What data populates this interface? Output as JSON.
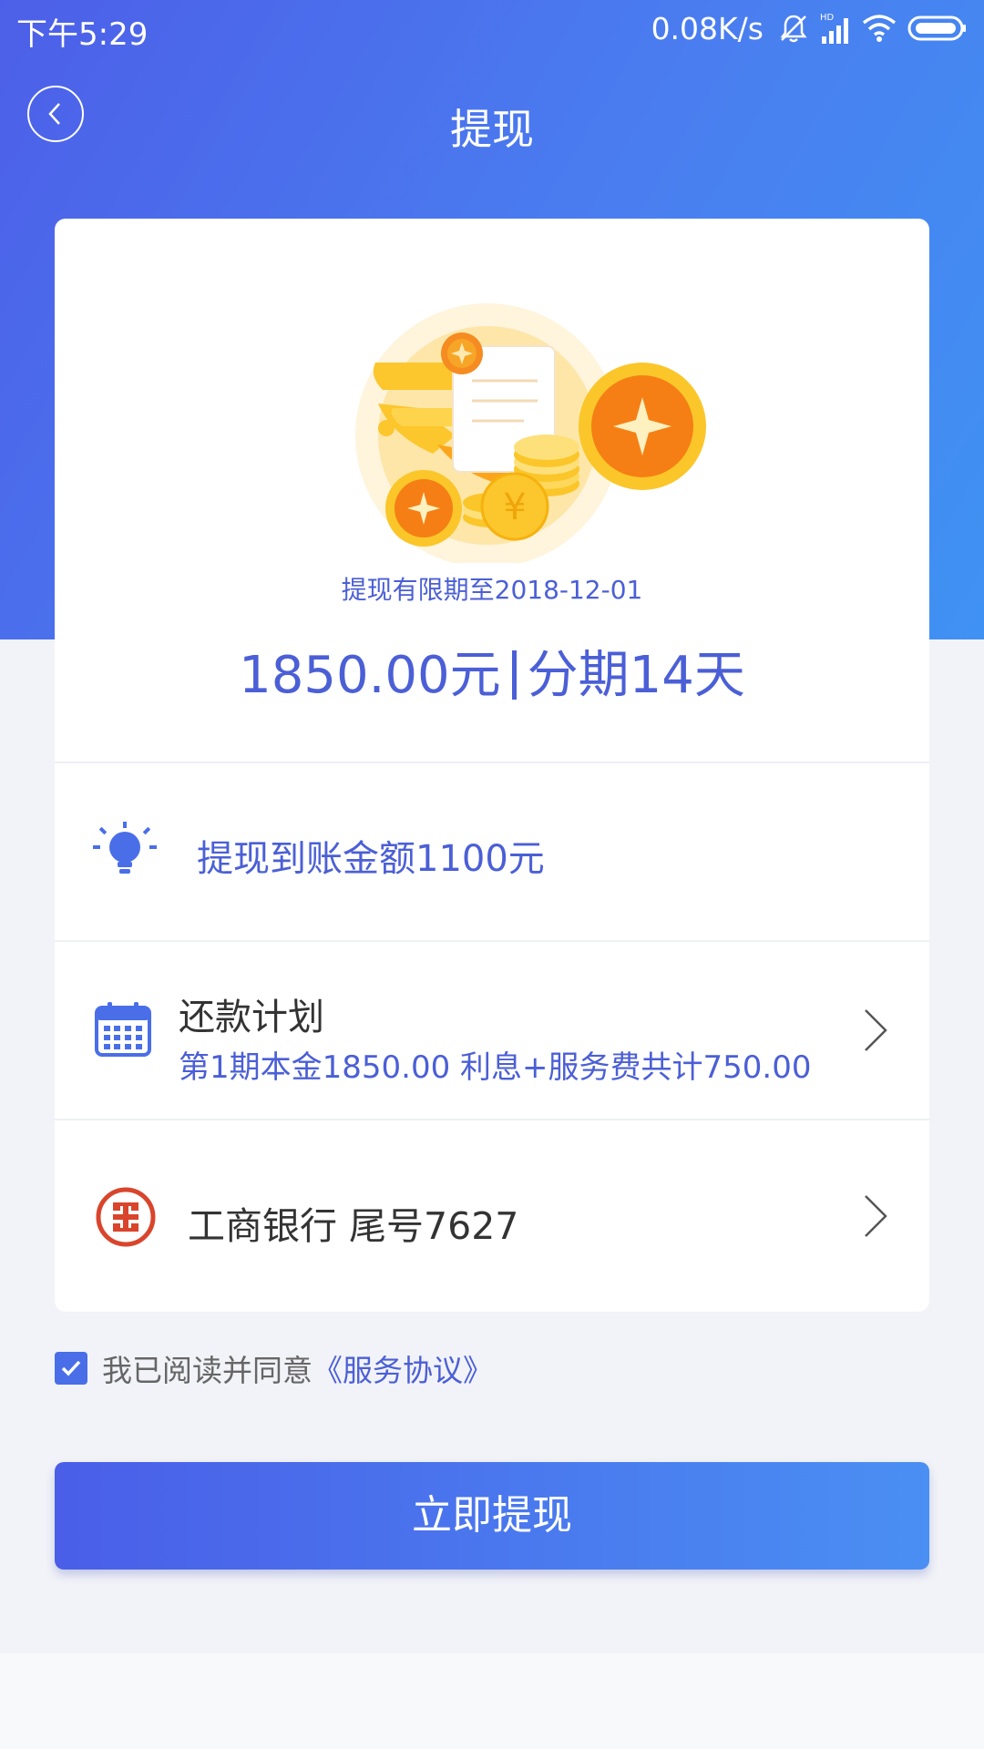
{
  "status_bar": {
    "time": "下午5:29",
    "net_speed": "0.08K/s",
    "icons": [
      "mute-bell-icon",
      "hd-signal-icon",
      "wifi-icon",
      "battery-icon"
    ],
    "hd_label": "HD"
  },
  "header": {
    "title": "提现",
    "back_icon": "back-chevron-icon"
  },
  "hero": {
    "illustration": "coins-document-illustration",
    "validity_text": "提现有限期至2018-12-01",
    "amount": "1850.00元",
    "term": "分期14天"
  },
  "arrival": {
    "icon": "lightbulb-icon",
    "text": "提现到账金额1100元"
  },
  "repayment_plan": {
    "icon": "calendar-icon",
    "title": "还款计划",
    "detail": "第1期本金1850.00  利息+服务费共计750.00"
  },
  "bank": {
    "icon": "icbc-logo",
    "text": "工商银行 尾号7627"
  },
  "agreement": {
    "checked": true,
    "text": "我已阅读并同意",
    "link": "《服务协议》"
  },
  "submit": {
    "label": "立即提现"
  },
  "colors": {
    "header_gradient_start": "#4c5fe8",
    "header_gradient_end": "#3f92f3",
    "accent_text": "#4b5fd6",
    "bank_red": "#d9452c"
  }
}
